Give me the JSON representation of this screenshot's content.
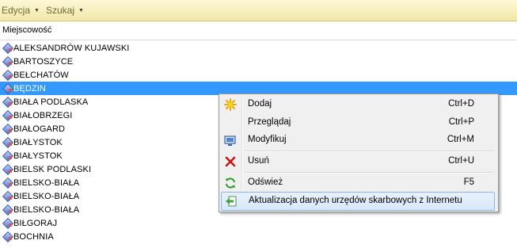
{
  "menubar": {
    "items": [
      {
        "label": "Edycja"
      },
      {
        "label": "Szukaj"
      }
    ]
  },
  "list": {
    "column_header": "Miejscowość",
    "rows": [
      "ALEKSANDRÓW KUJAWSKI",
      "BARTOSZYCE",
      "BEŁCHATÓW",
      "BĘDZIN",
      "BIAŁA PODLASKA",
      "BIAŁOBRZEGI",
      "BIAŁOGARD",
      "BIAŁYSTOK",
      "BIAŁYSTOK",
      "BIELSK PODLASKI",
      "BIELSKO-BIAŁA",
      "BIELSKO-BIAŁA",
      "BIELSKO-BIAŁA",
      "BIŁGORAJ",
      "BOCHNIA"
    ],
    "selected_index": 3
  },
  "context_menu": {
    "items": [
      {
        "label": "Dodaj",
        "shortcut": "Ctrl+D",
        "icon": "add-star-icon"
      },
      {
        "label": "Przeglądaj",
        "shortcut": "Ctrl+P",
        "icon": ""
      },
      {
        "label": "Modyfikuj",
        "shortcut": "Ctrl+M",
        "icon": "edit-monitor-icon"
      },
      {
        "label": "Usuń",
        "shortcut": "Ctrl+U",
        "icon": "delete-x-icon"
      },
      {
        "label": "Odśwież",
        "shortcut": "F5",
        "icon": "refresh-icon"
      },
      {
        "label": "Aktualizacja danych urzędów skarbowych z Internetu",
        "shortcut": "",
        "icon": "update-arrow-icon"
      }
    ],
    "highlighted_index": 5
  },
  "colors": {
    "selection": "#3399ff",
    "menubar_bg": "#f3e7a6"
  }
}
